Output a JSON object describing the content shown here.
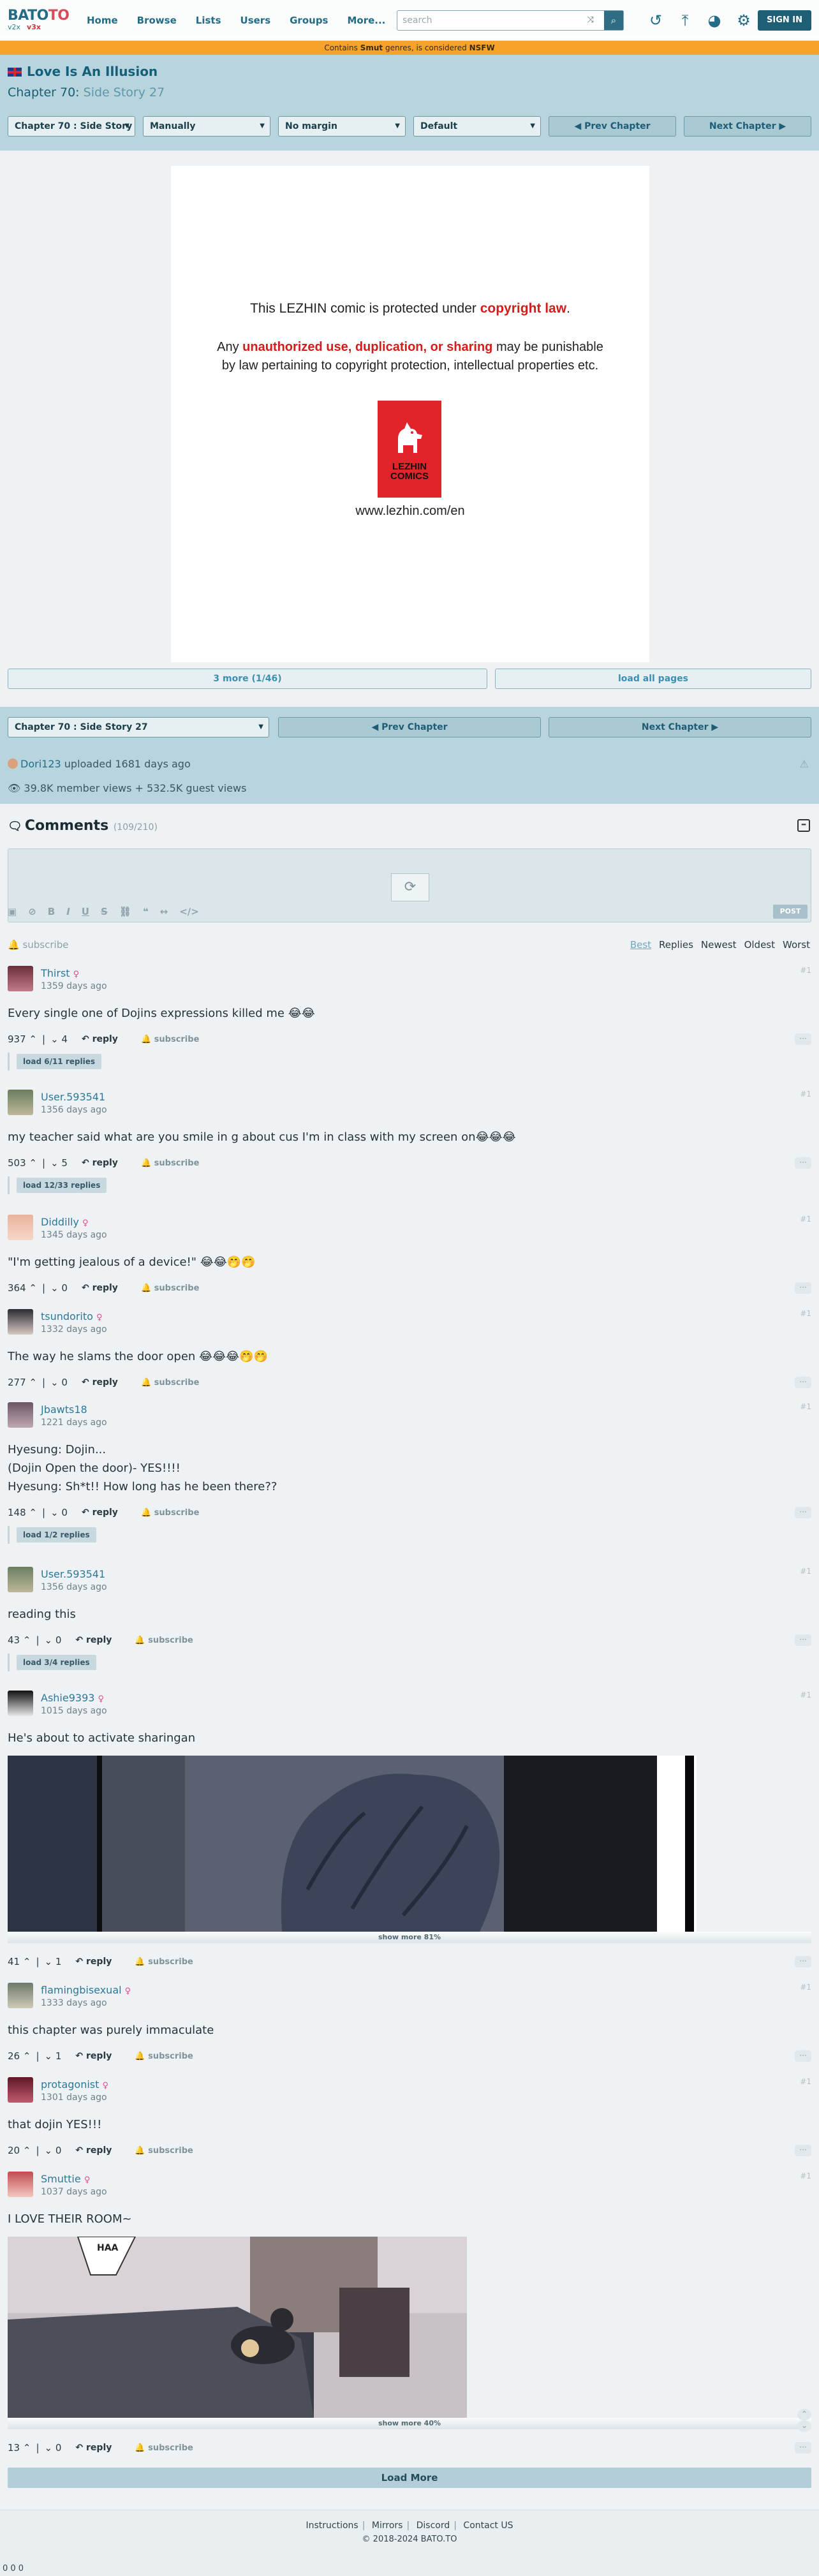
{
  "site": {
    "logo_main": "BATO",
    "logo_to": "TO",
    "logo_v": "v2x",
    "logo_v3": "v3x"
  },
  "nav": {
    "items": [
      "Home",
      "Browse",
      "Lists",
      "Users",
      "Groups",
      "More..."
    ],
    "search_placeholder": "search",
    "signin": "SIGN IN"
  },
  "warning": {
    "pre": "Contains",
    "genre": "Smut",
    "mid": "genres, is considered",
    "tag": "NSFW"
  },
  "series": {
    "title": "Love Is An Illusion",
    "chapter_label": "Chapter 70:",
    "chapter_sub": "Side Story 27"
  },
  "controls": {
    "chapter_select": "Chapter 70 : Side Story 27",
    "mode": "Manually",
    "margin": "No margin",
    "fit": "Default",
    "prev": "◀ Prev Chapter",
    "next": "Next Chapter ▶"
  },
  "page": {
    "line1_pre": "This LEZHIN comic is protected under ",
    "line1_red": "copyright law",
    "line1_post": ".",
    "line2_pre": "Any ",
    "line2_red": "unauthorized use, duplication, or sharing",
    "line2_post": " may be punishable",
    "line3": "by law pertaining to copyright protection, intellectual properties etc.",
    "logo_l1": "LEZHIN",
    "logo_l2": "COMICS",
    "url": "www.lezhin.com/en"
  },
  "pager": {
    "more": "3 more (1/46)",
    "all": "load all pages"
  },
  "upload": {
    "user": "Dori123",
    "rest": "uploaded 1681 days ago",
    "views": "39.8K member views + 532.5K guest views"
  },
  "comments": {
    "title": "Comments",
    "count": "(109/210)",
    "post": "POST",
    "subscribe": "subscribe",
    "sorts": [
      "Best",
      "Replies",
      "Newest",
      "Oldest",
      "Worst"
    ],
    "reply": "reply",
    "sub": "subscribe",
    "items": [
      {
        "user": "Thirst",
        "date": "1359 days ago",
        "text": [
          "Every single one of Dojins expressions killed me 😂😂"
        ],
        "up": "937",
        "down": "4",
        "replies": "load 6/11 replies",
        "num": "#1"
      },
      {
        "user": "User.593541",
        "date": "1356 days ago",
        "text": [
          "my teacher said what are you smile in g about cus I'm in class with my screen on😂😂😂"
        ],
        "up": "503",
        "down": "5",
        "replies": "load 12/33 replies",
        "num": "#1"
      },
      {
        "user": "Diddilly",
        "date": "1345 days ago",
        "text": [
          "\"I'm getting jealous of a device!\" 😂😂🤭🤭"
        ],
        "up": "364",
        "down": "0",
        "num": "#1"
      },
      {
        "user": "tsundorito",
        "date": "1332 days ago",
        "text": [
          "The way he slams the door open 😂😂😂🤭🤭"
        ],
        "up": "277",
        "down": "0",
        "num": "#1"
      },
      {
        "user": "Jbawts18",
        "date": "1221 days ago",
        "text": [
          "Hyesung: Dojin...",
          "(Dojin Open the door)- YES!!!!",
          "Hyesung: Sh*t!! How long has he been there??"
        ],
        "up": "148",
        "down": "0",
        "replies": "load 1/2 replies",
        "num": "#1"
      },
      {
        "user": "User.593541",
        "date": "1356 days ago",
        "text": [
          "reading this"
        ],
        "up": "43",
        "down": "0",
        "replies": "load 3/4 replies",
        "num": "#1"
      },
      {
        "user": "Ashie9393",
        "date": "1015 days ago",
        "text": [
          "He's about to activate sharingan"
        ],
        "up": "41",
        "down": "1",
        "showmore": "show more 81%",
        "num": "#1"
      },
      {
        "user": "flamingbisexual",
        "date": "1333 days ago",
        "text": [
          "this chapter was purely immaculate"
        ],
        "up": "26",
        "down": "1",
        "num": "#1"
      },
      {
        "user": "protagonist",
        "date": "1301 days ago",
        "text": [
          "that dojin YES!!!"
        ],
        "up": "20",
        "down": "0",
        "num": "#1"
      },
      {
        "user": "Smuttie",
        "date": "1037 days ago",
        "text": [
          "I LOVE THEIR ROOM~"
        ],
        "up": "13",
        "down": "0",
        "showmore": "show more 40%",
        "bubble": "HAA",
        "num": "#1"
      }
    ],
    "load_more": "Load More"
  },
  "footer": {
    "links": [
      "Instructions",
      "Mirrors",
      "Discord",
      "Contact US"
    ],
    "copy": "© 2018-2024 BATO.TO",
    "counter": "0 0 0"
  },
  "colors": {
    "accent": "#1f5f76",
    "warning": "#f7a22a",
    "header_bg": "#b8d4dc",
    "red": "#d21d1d"
  }
}
